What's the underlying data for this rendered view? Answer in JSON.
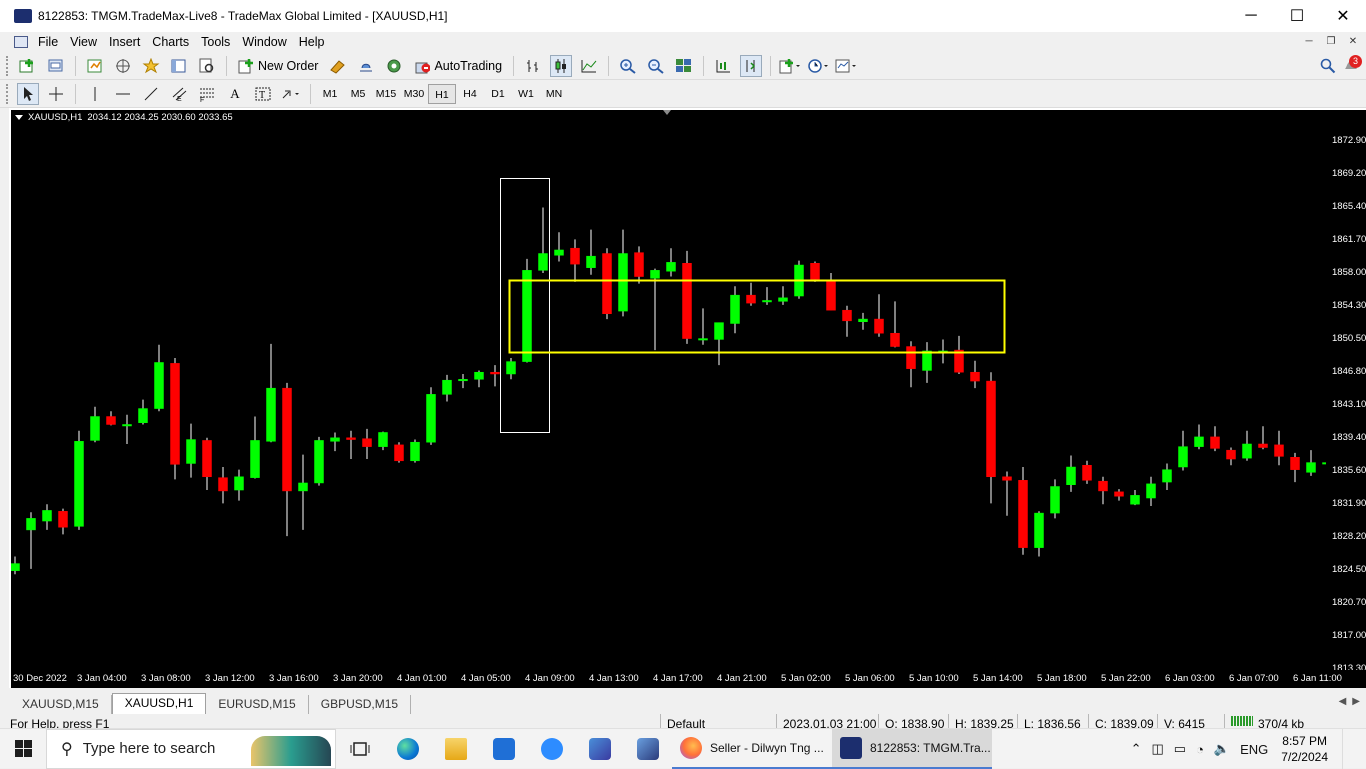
{
  "window": {
    "title": "8122853: TMGM.TradeMax-Live8 - TradeMax Global Limited - [XAUUSD,H1]",
    "buttons": {
      "minimize": "─",
      "maximize": "☐",
      "close": "✕"
    }
  },
  "menu": {
    "items": [
      "File",
      "View",
      "Insert",
      "Charts",
      "Tools",
      "Window",
      "Help"
    ],
    "mdi": {
      "minimize": "─",
      "restore": "❐",
      "close": "✕"
    }
  },
  "toolbar": {
    "new_order_label": "New Order",
    "autotrading_label": "AutoTrading",
    "notification_count": "3",
    "timeframes": [
      "M1",
      "M5",
      "M15",
      "M30",
      "H1",
      "H4",
      "D1",
      "W1",
      "MN"
    ],
    "active_timeframe": "H1"
  },
  "chart": {
    "symbol_header": "XAUUSD,H1",
    "ohlc_header": "2034.12 2034.25 2030.60 2033.65",
    "colors": {
      "bull": "#00ff00",
      "bear": "#ff0000",
      "background": "#000000",
      "axis_text": "#ffffff",
      "box_white": "#ffffff",
      "box_yellow": "#ffff00"
    }
  },
  "chart_data": {
    "type": "candlestick",
    "price_ticks": [
      "1872.90",
      "1869.20",
      "1865.40",
      "1861.70",
      "1858.00",
      "1854.30",
      "1850.50",
      "1846.80",
      "1843.10",
      "1839.40",
      "1835.60",
      "1831.90",
      "1828.20",
      "1824.50",
      "1820.70",
      "1817.00",
      "1813.30"
    ],
    "ylim": [
      1813.3,
      1872.9
    ],
    "time_ticks": [
      "30 Dec 2022",
      "3 Jan 04:00",
      "3 Jan 08:00",
      "3 Jan 12:00",
      "3 Jan 16:00",
      "3 Jan 20:00",
      "4 Jan 01:00",
      "4 Jan 05:00",
      "4 Jan 09:00",
      "4 Jan 13:00",
      "4 Jan 17:00",
      "4 Jan 21:00",
      "5 Jan 02:00",
      "5 Jan 06:00",
      "5 Jan 10:00",
      "5 Jan 14:00",
      "5 Jan 18:00",
      "5 Jan 22:00",
      "6 Jan 03:00",
      "6 Jan 07:00",
      "6 Jan 11:00"
    ],
    "candles": [
      {
        "o": 1824.4,
        "h": 1826.0,
        "l": 1824.0,
        "c": 1825.2
      },
      {
        "o": 1829.0,
        "h": 1831.0,
        "l": 1824.6,
        "c": 1830.3
      },
      {
        "o": 1830.0,
        "h": 1831.9,
        "l": 1829.0,
        "c": 1831.2
      },
      {
        "o": 1831.1,
        "h": 1831.4,
        "l": 1828.5,
        "c": 1829.3
      },
      {
        "o": 1829.4,
        "h": 1840.2,
        "l": 1829.0,
        "c": 1839.0
      },
      {
        "o": 1839.1,
        "h": 1842.9,
        "l": 1838.9,
        "c": 1841.8
      },
      {
        "o": 1841.8,
        "h": 1842.4,
        "l": 1840.8,
        "c": 1840.9
      },
      {
        "o": 1840.9,
        "h": 1842.0,
        "l": 1838.7,
        "c": 1840.9
      },
      {
        "o": 1841.1,
        "h": 1843.7,
        "l": 1840.9,
        "c": 1842.7
      },
      {
        "o": 1842.7,
        "h": 1849.9,
        "l": 1842.4,
        "c": 1847.9
      },
      {
        "o": 1847.8,
        "h": 1848.4,
        "l": 1834.7,
        "c": 1836.4
      },
      {
        "o": 1836.5,
        "h": 1841.0,
        "l": 1834.9,
        "c": 1839.2
      },
      {
        "o": 1839.1,
        "h": 1839.4,
        "l": 1833.5,
        "c": 1835.0
      },
      {
        "o": 1834.9,
        "h": 1836.1,
        "l": 1832.0,
        "c": 1833.4
      },
      {
        "o": 1833.5,
        "h": 1835.8,
        "l": 1832.3,
        "c": 1835.0
      },
      {
        "o": 1834.9,
        "h": 1841.8,
        "l": 1834.8,
        "c": 1839.1
      },
      {
        "o": 1839.0,
        "h": 1850.0,
        "l": 1838.9,
        "c": 1845.0
      },
      {
        "o": 1845.0,
        "h": 1845.6,
        "l": 1828.3,
        "c": 1833.4
      },
      {
        "o": 1833.4,
        "h": 1837.5,
        "l": 1829.0,
        "c": 1834.3
      },
      {
        "o": 1834.3,
        "h": 1839.5,
        "l": 1834.0,
        "c": 1839.1
      },
      {
        "o": 1839.0,
        "h": 1840.0,
        "l": 1837.9,
        "c": 1839.4
      },
      {
        "o": 1839.4,
        "h": 1840.2,
        "l": 1837.0,
        "c": 1839.2
      },
      {
        "o": 1839.3,
        "h": 1840.4,
        "l": 1837.0,
        "c": 1838.4
      },
      {
        "o": 1838.4,
        "h": 1840.1,
        "l": 1838.0,
        "c": 1840.0
      },
      {
        "o": 1838.6,
        "h": 1838.9,
        "l": 1836.6,
        "c": 1836.8
      },
      {
        "o": 1836.8,
        "h": 1839.2,
        "l": 1836.6,
        "c": 1838.9
      },
      {
        "o": 1838.9,
        "h": 1845.1,
        "l": 1838.6,
        "c": 1844.3
      },
      {
        "o": 1844.3,
        "h": 1846.5,
        "l": 1843.5,
        "c": 1845.9
      },
      {
        "o": 1845.9,
        "h": 1846.6,
        "l": 1845.0,
        "c": 1846.0
      },
      {
        "o": 1846.0,
        "h": 1847.0,
        "l": 1845.1,
        "c": 1846.8
      },
      {
        "o": 1846.8,
        "h": 1847.6,
        "l": 1845.2,
        "c": 1846.6
      },
      {
        "o": 1846.6,
        "h": 1848.4,
        "l": 1846.0,
        "c": 1848.0
      },
      {
        "o": 1848.0,
        "h": 1859.6,
        "l": 1847.9,
        "c": 1858.3
      },
      {
        "o": 1858.3,
        "h": 1865.4,
        "l": 1858.0,
        "c": 1860.2
      },
      {
        "o": 1860.0,
        "h": 1862.6,
        "l": 1859.3,
        "c": 1860.6
      },
      {
        "o": 1860.8,
        "h": 1861.8,
        "l": 1857.0,
        "c": 1859.0
      },
      {
        "o": 1858.6,
        "h": 1862.9,
        "l": 1857.8,
        "c": 1859.9
      },
      {
        "o": 1860.2,
        "h": 1860.8,
        "l": 1852.8,
        "c": 1853.4
      },
      {
        "o": 1853.7,
        "h": 1862.9,
        "l": 1853.1,
        "c": 1860.2
      },
      {
        "o": 1860.3,
        "h": 1861.0,
        "l": 1856.8,
        "c": 1857.6
      },
      {
        "o": 1857.4,
        "h": 1858.5,
        "l": 1849.3,
        "c": 1858.3
      },
      {
        "o": 1858.2,
        "h": 1860.8,
        "l": 1857.6,
        "c": 1859.2
      },
      {
        "o": 1859.1,
        "h": 1860.5,
        "l": 1850.0,
        "c": 1850.6
      },
      {
        "o": 1850.5,
        "h": 1854.0,
        "l": 1849.9,
        "c": 1850.6
      },
      {
        "o": 1850.5,
        "h": 1852.4,
        "l": 1847.6,
        "c": 1852.4
      },
      {
        "o": 1852.3,
        "h": 1856.5,
        "l": 1851.2,
        "c": 1855.5
      },
      {
        "o": 1855.5,
        "h": 1856.9,
        "l": 1854.3,
        "c": 1854.6
      },
      {
        "o": 1854.8,
        "h": 1856.4,
        "l": 1854.4,
        "c": 1854.9
      },
      {
        "o": 1854.8,
        "h": 1856.5,
        "l": 1854.4,
        "c": 1855.2
      },
      {
        "o": 1855.4,
        "h": 1859.4,
        "l": 1855.1,
        "c": 1858.9
      },
      {
        "o": 1859.1,
        "h": 1859.3,
        "l": 1857.0,
        "c": 1857.3
      },
      {
        "o": 1857.2,
        "h": 1858.0,
        "l": 1853.8,
        "c": 1853.8
      },
      {
        "o": 1853.8,
        "h": 1854.3,
        "l": 1850.8,
        "c": 1852.6
      },
      {
        "o": 1852.5,
        "h": 1853.5,
        "l": 1851.6,
        "c": 1852.8
      },
      {
        "o": 1852.8,
        "h": 1855.6,
        "l": 1850.8,
        "c": 1851.2
      },
      {
        "o": 1851.2,
        "h": 1854.8,
        "l": 1849.6,
        "c": 1849.7
      },
      {
        "o": 1849.7,
        "h": 1850.3,
        "l": 1845.1,
        "c": 1847.2
      },
      {
        "o": 1847.0,
        "h": 1850.2,
        "l": 1845.6,
        "c": 1849.2
      },
      {
        "o": 1849.0,
        "h": 1850.5,
        "l": 1847.8,
        "c": 1849.2
      },
      {
        "o": 1849.3,
        "h": 1850.9,
        "l": 1846.6,
        "c": 1846.8
      },
      {
        "o": 1846.8,
        "h": 1848.1,
        "l": 1845.0,
        "c": 1845.8
      },
      {
        "o": 1845.8,
        "h": 1846.8,
        "l": 1832.0,
        "c": 1835.0
      },
      {
        "o": 1835.0,
        "h": 1835.6,
        "l": 1830.6,
        "c": 1834.6
      },
      {
        "o": 1834.6,
        "h": 1836.1,
        "l": 1826.2,
        "c": 1827.0
      },
      {
        "o": 1827.0,
        "h": 1831.1,
        "l": 1826.0,
        "c": 1830.9
      },
      {
        "o": 1830.9,
        "h": 1834.7,
        "l": 1830.3,
        "c": 1833.9
      },
      {
        "o": 1834.1,
        "h": 1837.4,
        "l": 1833.3,
        "c": 1836.1
      },
      {
        "o": 1836.3,
        "h": 1836.8,
        "l": 1834.2,
        "c": 1834.6
      },
      {
        "o": 1834.5,
        "h": 1835.0,
        "l": 1831.9,
        "c": 1833.4
      },
      {
        "o": 1833.3,
        "h": 1833.6,
        "l": 1832.3,
        "c": 1832.8
      },
      {
        "o": 1831.9,
        "h": 1833.5,
        "l": 1831.8,
        "c": 1832.9
      },
      {
        "o": 1832.6,
        "h": 1835.0,
        "l": 1831.7,
        "c": 1834.2
      },
      {
        "o": 1834.4,
        "h": 1836.5,
        "l": 1833.5,
        "c": 1835.8
      },
      {
        "o": 1836.1,
        "h": 1840.2,
        "l": 1835.7,
        "c": 1838.4
      },
      {
        "o": 1838.4,
        "h": 1840.9,
        "l": 1838.1,
        "c": 1839.5
      },
      {
        "o": 1839.5,
        "h": 1840.7,
        "l": 1837.9,
        "c": 1838.2
      },
      {
        "o": 1838.0,
        "h": 1838.3,
        "l": 1836.3,
        "c": 1837.0
      },
      {
        "o": 1837.1,
        "h": 1840.2,
        "l": 1836.8,
        "c": 1838.7
      },
      {
        "o": 1838.7,
        "h": 1840.7,
        "l": 1838.1,
        "c": 1838.3
      },
      {
        "o": 1838.6,
        "h": 1840.2,
        "l": 1836.3,
        "c": 1837.3
      },
      {
        "o": 1837.2,
        "h": 1837.7,
        "l": 1834.4,
        "c": 1835.8
      },
      {
        "o": 1835.5,
        "h": 1838.0,
        "l": 1835.1,
        "c": 1836.6
      },
      {
        "o": 1836.6,
        "h": 1838.9,
        "l": 1836.2,
        "c": 1836.6
      }
    ]
  },
  "tabs": [
    "XAUUSD,M15",
    "XAUUSD,H1",
    "EURUSD,M15",
    "GBPUSD,M15"
  ],
  "active_tab": "XAUUSD,H1",
  "status": {
    "help": "For Help, press F1",
    "profile": "Default",
    "datetime": "2023.01.03 21:00",
    "open": "O: 1838.90",
    "high": "H: 1839.25",
    "low": "L: 1836.56",
    "close": "C: 1839.09",
    "volume": "V: 6415",
    "traffic": "370/4 kb"
  },
  "taskbar": {
    "search_placeholder": "Type here to search",
    "windows": [
      "Seller - Dilwyn Tng ...",
      "8122853: TMGM.Tra..."
    ],
    "language": "ENG",
    "time": "8:57 PM",
    "date": "7/2/2024"
  }
}
